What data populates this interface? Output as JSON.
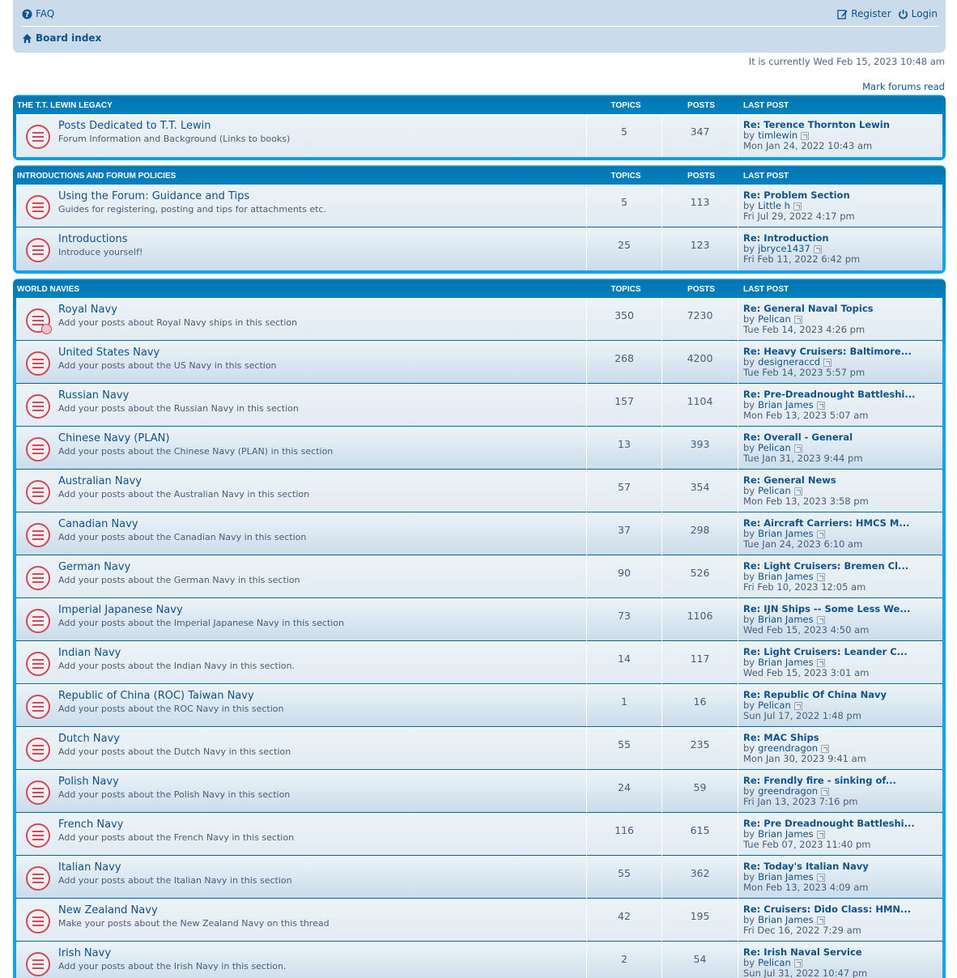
{
  "nav": {
    "faq": "FAQ",
    "register": "Register",
    "login": "Login",
    "board_index": "Board index"
  },
  "status_text": "It is currently Wed Feb 15, 2023 10:48 am",
  "mark_forums_read": "Mark forums read",
  "headers": {
    "topics": "TOPICS",
    "posts": "POSTS",
    "last_post": "LAST POST"
  },
  "categories": [
    {
      "title": "THE T.T. LEWIN LEGACY",
      "forums": [
        {
          "name": "Posts Dedicated to T.T. Lewin",
          "desc": "Forum Information and Background (Links to books)",
          "topics": "5",
          "posts": "347",
          "last_title": "Re: Terence Thornton Lewin",
          "last_user": "timlewin",
          "last_time": "Mon Jan 24, 2022 10:43 am"
        }
      ]
    },
    {
      "title": "INTRODUCTIONS AND FORUM POLICIES",
      "forums": [
        {
          "name": "Using the Forum: Guidance and Tips",
          "desc": "Guides for registering, posting and tips for attachments etc.",
          "topics": "5",
          "posts": "113",
          "last_title": "Re: Problem Section",
          "last_user": "Little h",
          "last_time": "Fri Jul 29, 2022 4:17 pm"
        },
        {
          "name": "Introductions",
          "desc": "Introduce yourself!",
          "topics": "25",
          "posts": "123",
          "last_title": "Re: Introduction",
          "last_user": "jbryce1437",
          "last_time": "Fri Feb 11, 2022 6:42 pm"
        }
      ]
    },
    {
      "title": "WORLD NAVIES",
      "forums": [
        {
          "name": "Royal Navy",
          "desc": "Add your posts about Royal Navy ships in this section",
          "topics": "350",
          "posts": "7230",
          "last_title": "Re: General Naval Topics",
          "last_user": "Pelican",
          "last_time": "Tue Feb 14, 2023 4:26 pm"
        },
        {
          "name": "United States Navy",
          "desc": "Add your posts about the US Navy in this section",
          "topics": "268",
          "posts": "4200",
          "last_title": "Re: Heavy Cruisers: Baltimore...",
          "last_user": "designeraccd",
          "last_time": "Tue Feb 14, 2023 5:57 pm"
        },
        {
          "name": "Russian Navy",
          "desc": "Add your posts about the Russian Navy in this section",
          "topics": "157",
          "posts": "1104",
          "last_title": "Re: Pre-Dreadnought Battleshi...",
          "last_user": "Brian James",
          "last_time": "Mon Feb 13, 2023 5:07 am"
        },
        {
          "name": "Chinese Navy (PLAN)",
          "desc": "Add your posts about the Chinese Navy (PLAN) in this section",
          "topics": "13",
          "posts": "393",
          "last_title": "Re: Overall - General",
          "last_user": "Pelican",
          "last_time": "Tue Jan 31, 2023 9:44 pm"
        },
        {
          "name": "Australian Navy",
          "desc": "Add your posts about the Australian Navy in this section",
          "topics": "57",
          "posts": "354",
          "last_title": "Re: General News",
          "last_user": "Pelican",
          "last_time": "Mon Feb 13, 2023 3:58 pm"
        },
        {
          "name": "Canadian Navy",
          "desc": "Add your posts about the Canadian Navy in this section",
          "topics": "37",
          "posts": "298",
          "last_title": "Re: Aircraft Carriers: HMCS M...",
          "last_user": "Brian James",
          "last_time": "Tue Jan 24, 2023 6:10 am"
        },
        {
          "name": "German Navy",
          "desc": "Add your posts about the German Navy in this section",
          "topics": "90",
          "posts": "526",
          "last_title": "Re: Light Cruisers: Bremen Cl...",
          "last_user": "Brian James",
          "last_time": "Fri Feb 10, 2023 12:05 am"
        },
        {
          "name": "Imperial Japanese Navy",
          "desc": "Add your posts about the Imperial Japanese Navy in this section",
          "topics": "73",
          "posts": "1106",
          "last_title": "Re: IJN Ships -- Some Less We...",
          "last_user": "Brian James",
          "last_time": "Wed Feb 15, 2023 4:50 am"
        },
        {
          "name": "Indian Navy",
          "desc": "Add your posts about the Indian Navy in this section.",
          "topics": "14",
          "posts": "117",
          "last_title": "Re: Light Cruisers: Leander C...",
          "last_user": "Brian James",
          "last_time": "Wed Feb 15, 2023 3:01 am"
        },
        {
          "name": "Republic of China (ROC) Taiwan Navy",
          "desc": "Add your posts about the ROC Navy in this section",
          "topics": "1",
          "posts": "16",
          "last_title": "Re: Republic Of China Navy",
          "last_user": "Pelican",
          "last_time": "Sun Jul 17, 2022 1:48 pm"
        },
        {
          "name": "Dutch Navy",
          "desc": "Add your posts about the Dutch Navy in this section",
          "topics": "55",
          "posts": "235",
          "last_title": "Re: MAC Ships",
          "last_user": "greendragon",
          "last_time": "Mon Jan 30, 2023 9:41 am"
        },
        {
          "name": "Polish Navy",
          "desc": "Add your posts about the Polish Navy in this section",
          "topics": "24",
          "posts": "59",
          "last_title": "Re: Frendly fire - sinking of...",
          "last_user": "greendragon",
          "last_time": "Fri Jan 13, 2023 7:16 pm"
        },
        {
          "name": "French Navy",
          "desc": "Add your posts about the French Navy in this section",
          "topics": "116",
          "posts": "615",
          "last_title": "Re: Pre Dreadnought Battleshi...",
          "last_user": "Brian James",
          "last_time": "Tue Feb 07, 2023 11:40 pm"
        },
        {
          "name": "Italian Navy",
          "desc": "Add your posts about the Italian Navy in this section",
          "topics": "55",
          "posts": "362",
          "last_title": "Re: Today's Italian Navy",
          "last_user": "Brian James",
          "last_time": "Mon Feb 13, 2023 4:09 am"
        },
        {
          "name": "New Zealand Navy",
          "desc": "Make your posts about the New Zealand Navy on this thread",
          "topics": "42",
          "posts": "195",
          "last_title": "Re: Cruisers: Dido Class: HMN...",
          "last_user": "Brian James",
          "last_time": "Fri Dec 16, 2022 7:29 am"
        },
        {
          "name": "Irish Navy",
          "desc": "Add your posts about the Irish Navy in this section.",
          "topics": "2",
          "posts": "54",
          "last_title": "Re: Irish Naval Service",
          "last_user": "Pelican",
          "last_time": "Sun Jul 31, 2022 10:47 pm"
        }
      ]
    }
  ]
}
